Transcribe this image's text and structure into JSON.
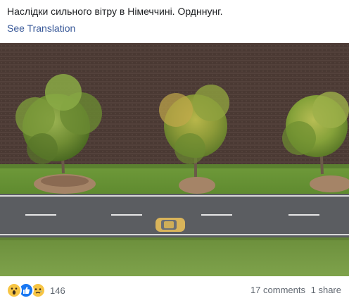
{
  "post": {
    "text": "Наслідки сильного вітру в Німеччині. Ордннунг.",
    "see_translation": "See Translation"
  },
  "photo": {
    "icon": "aerial-road-photo"
  },
  "footer": {
    "reaction_count": "146",
    "reaction_icons": [
      "wow-reaction-icon",
      "like-reaction-icon",
      "sad-reaction-icon"
    ],
    "comments": "17 comments",
    "shares": "1 share"
  },
  "colors": {
    "link": "#385898",
    "text": "#1c1e21",
    "meta": "#606770",
    "like_blue": "#1877f2",
    "emoji_yellow": "#f7c544"
  }
}
